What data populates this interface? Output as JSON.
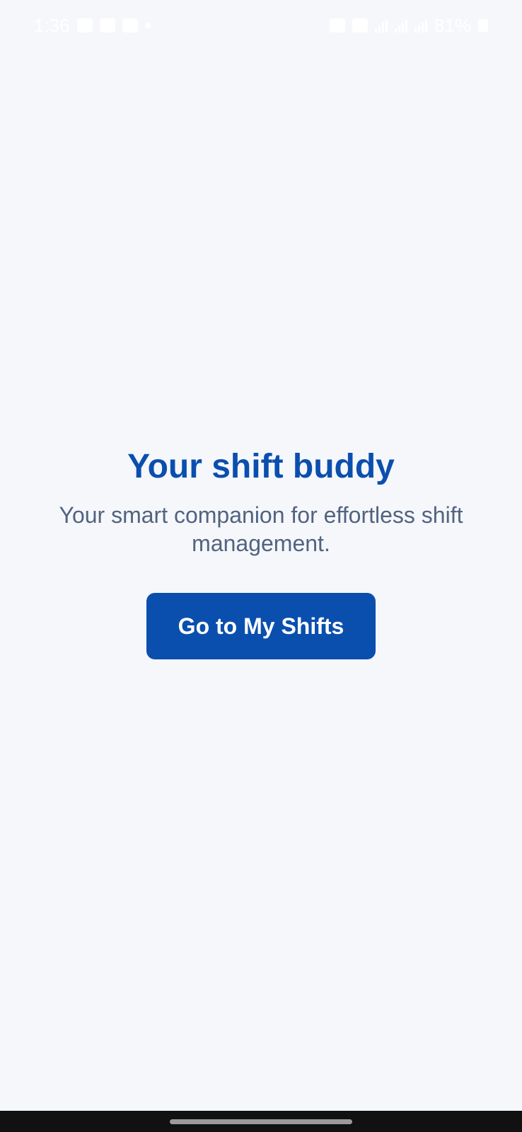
{
  "status_bar": {
    "time": "1:36",
    "battery": "81%",
    "icons": [
      "gallery-icon",
      "youtube-icon",
      "instagram-icon",
      "dot-icon",
      "alarm-icon",
      "mute-icon",
      "wifi-icon",
      "signal-icon",
      "signal-icon",
      "battery-icon"
    ]
  },
  "main": {
    "title": "Your shift buddy",
    "subtitle": "Your smart companion for effortless shift management.",
    "cta_label": "Go to My Shifts"
  },
  "colors": {
    "background": "#f5f7fb",
    "primary": "#0b4fae",
    "subtitle": "#526380"
  }
}
